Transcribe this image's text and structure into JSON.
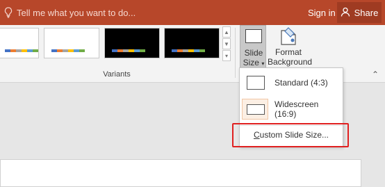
{
  "titlebar": {
    "tell_placeholder": "Tell me what you want to do...",
    "signin_label": "Sign in",
    "share_label": "Share",
    "bg_color": "#b7472a"
  },
  "ribbon": {
    "group_label": "Variants",
    "slide_size": {
      "line1": "Slide",
      "line2": "Size"
    },
    "format_bg": {
      "line1": "Format",
      "line2": "Background"
    }
  },
  "thumbnails": [
    {
      "bg": "#ffffff",
      "swatches": [
        "#4472c4",
        "#ed7d31",
        "#a5a5a5",
        "#ffc000",
        "#5b9bd5",
        "#70ad47"
      ]
    },
    {
      "bg": "#ffffff",
      "swatches": [
        "#4472c4",
        "#ed7d31",
        "#a5a5a5",
        "#ffc000",
        "#5b9bd5",
        "#70ad47"
      ]
    },
    {
      "bg": "#000000",
      "swatches": [
        "#4472c4",
        "#ed7d31",
        "#a5a5a5",
        "#ffc000",
        "#5b9bd5",
        "#70ad47"
      ]
    },
    {
      "bg": "#000000",
      "swatches": [
        "#4472c4",
        "#ed7d31",
        "#a5a5a5",
        "#ffc000",
        "#5b9bd5",
        "#70ad47"
      ]
    }
  ],
  "menu": {
    "standard_label": "Standard (4:3)",
    "widescreen_label": "Widescreen (16:9)",
    "custom_label_before": "",
    "custom_label_underlined": "C",
    "custom_label_after": "ustom Slide Size...",
    "highlight_color": "#e02020"
  }
}
